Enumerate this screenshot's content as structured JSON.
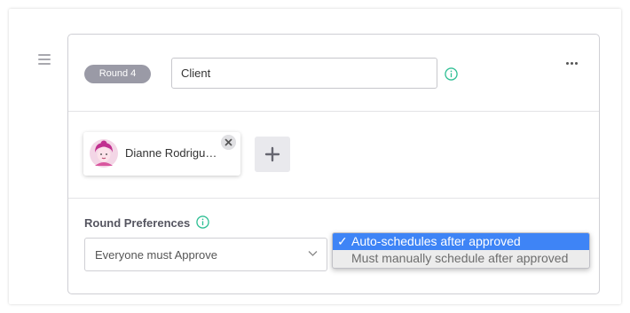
{
  "round": {
    "badge_label": "Round 4",
    "name_value": "Client"
  },
  "reviewers": [
    {
      "name": "Dianne Rodrigu…"
    }
  ],
  "preferences": {
    "label": "Round Preferences",
    "approval_select": {
      "selected": "Everyone must Approve"
    },
    "schedule_dropdown": {
      "options": [
        {
          "label": "Auto-schedules after approved",
          "checkmark": "✓",
          "selected": true
        },
        {
          "label": "Must manually schedule after approved",
          "selected": false
        }
      ]
    }
  },
  "colors": {
    "accent_info": "#2fbf94",
    "badge_bg": "#9a9aa6",
    "dropdown_highlight": "#3e84f6",
    "avatar_accent": "#c0308f"
  },
  "icons": {
    "drag": "drag-handle-icon",
    "info": "info-icon",
    "more": "more-horizontal-icon",
    "close": "close-icon",
    "add": "plus-icon",
    "chevron": "chevron-down-icon"
  }
}
